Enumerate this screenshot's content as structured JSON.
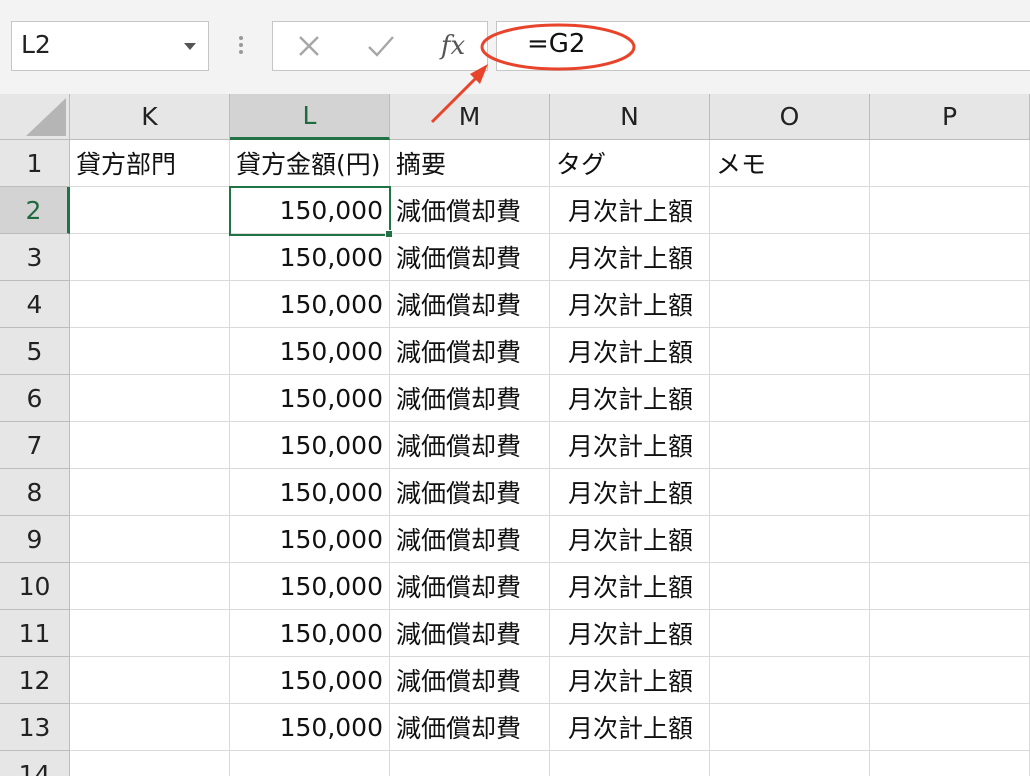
{
  "formula_bar": {
    "name_box": "L2",
    "cancel_icon": "close-icon",
    "enter_icon": "check-icon",
    "fx_label": "fx",
    "formula": "=G2"
  },
  "columns": [
    "K",
    "L",
    "M",
    "N",
    "O",
    "P"
  ],
  "selected_column": "L",
  "selected_row": "2",
  "header_row": {
    "row": "1",
    "K": "貸方部門",
    "L": "貸方金額(円)",
    "M": "摘要",
    "N": "タグ",
    "O": "メモ",
    "P": ""
  },
  "rows": [
    {
      "row": "2",
      "L": "150,000",
      "M": "減価償却費",
      "N": "月次計上額"
    },
    {
      "row": "3",
      "L": "150,000",
      "M": "減価償却費",
      "N": "月次計上額"
    },
    {
      "row": "4",
      "L": "150,000",
      "M": "減価償却費",
      "N": "月次計上額"
    },
    {
      "row": "5",
      "L": "150,000",
      "M": "減価償却費",
      "N": "月次計上額"
    },
    {
      "row": "6",
      "L": "150,000",
      "M": "減価償却費",
      "N": "月次計上額"
    },
    {
      "row": "7",
      "L": "150,000",
      "M": "減価償却費",
      "N": "月次計上額"
    },
    {
      "row": "8",
      "L": "150,000",
      "M": "減価償却費",
      "N": "月次計上額"
    },
    {
      "row": "9",
      "L": "150,000",
      "M": "減価償却費",
      "N": "月次計上額"
    },
    {
      "row": "10",
      "L": "150,000",
      "M": "減価償却費",
      "N": "月次計上額"
    },
    {
      "row": "11",
      "L": "150,000",
      "M": "減価償却費",
      "N": "月次計上額"
    },
    {
      "row": "12",
      "L": "150,000",
      "M": "減価償却費",
      "N": "月次計上額"
    },
    {
      "row": "13",
      "L": "150,000",
      "M": "減価償却費",
      "N": "月次計上額"
    }
  ],
  "partial_row": "14",
  "colors": {
    "selection": "#217346",
    "annotation": "#e8442b",
    "header_bg": "#e6e6e6"
  }
}
